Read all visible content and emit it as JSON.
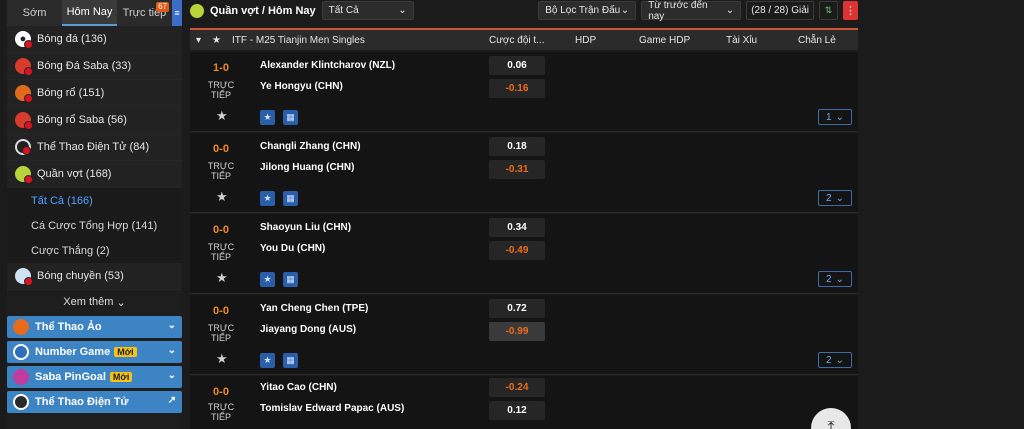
{
  "sidebar": {
    "tabs": [
      {
        "label": "Sớm"
      },
      {
        "label": "Hôm Nay"
      },
      {
        "label": "Trực tiếp",
        "badge": "67"
      }
    ],
    "sports": [
      {
        "label": "Bóng đá (136)",
        "icon": "soccer-icon",
        "color": "#ffffff"
      },
      {
        "label": "Bóng Đá Saba (33)",
        "icon": "soccer-saba-icon",
        "color": "#d83a2e"
      },
      {
        "label": "Bóng rổ (151)",
        "icon": "basketball-icon",
        "color": "#e06a1b"
      },
      {
        "label": "Bóng rổ Saba (56)",
        "icon": "basketball-saba-icon",
        "color": "#d83a2e"
      },
      {
        "label": "Thể Thao Điện Tử (84)",
        "icon": "esports-headset-icon",
        "color": "#dddddd"
      },
      {
        "label": "Quần vợt (168)",
        "icon": "tennis-icon",
        "color": "#b7d43a"
      }
    ],
    "tennis_subs": [
      {
        "label": "Tất Cả (166)"
      },
      {
        "label": "Cá Cược Tổng Hợp (141)"
      },
      {
        "label": "Cược Thắng (2)"
      }
    ],
    "volleyball": {
      "label": "Bóng chuyền (53)",
      "icon": "volleyball-icon"
    },
    "more": "Xem thêm",
    "promos": [
      {
        "label": "Thể Thao Ảo",
        "icon": "virtual-sports-icon",
        "badge": ""
      },
      {
        "label": "Number Game",
        "icon": "number-game-icon",
        "badge": "Mới"
      },
      {
        "label": "Saba PinGoal",
        "icon": "pingoal-icon",
        "badge": "Mới"
      },
      {
        "label": "Thể Thao Điện Tử",
        "icon": "esports-icon",
        "badge": ""
      }
    ]
  },
  "topbar": {
    "title": "Quần vợt / Hôm Nay",
    "filter_value": "Tất Cả",
    "match_filter": "Bộ Lọc Trận Đấu",
    "time_filter": "Từ trước đến nay",
    "count": "(28 / 28) Giải"
  },
  "table": {
    "league": "ITF - M25 Tianjin Men Singles",
    "columns": [
      "Cược đội t...",
      "HDP",
      "Game HDP",
      "Tài Xỉu",
      "Chẵn Lẻ"
    ]
  },
  "matches": [
    {
      "score": "1-0",
      "status": "TRỰC TIẾP",
      "home": "Alexander Klintcharov (NZL)",
      "away": "Ye Hongyu (CHN)",
      "odd_home": "0.06",
      "odd_away": "-0.16",
      "more": "1"
    },
    {
      "score": "0-0",
      "status": "TRỰC TIẾP",
      "home": "Changli Zhang (CHN)",
      "away": "Jilong Huang (CHN)",
      "odd_home": "0.18",
      "odd_away": "-0.31",
      "more": "2"
    },
    {
      "score": "0-0",
      "status": "TRỰC TIẾP",
      "home": "Shaoyun Liu (CHN)",
      "away": "You Du (CHN)",
      "odd_home": "0.34",
      "odd_away": "-0.49",
      "more": "2"
    },
    {
      "score": "0-0",
      "status": "TRỰC TIẾP",
      "home": "Yan Cheng Chen (TPE)",
      "away": "Jiayang Dong (AUS)",
      "odd_home": "0.72",
      "odd_away": "-0.99",
      "more": "2"
    },
    {
      "score": "0-0",
      "status": "TRỰC TIẾP",
      "home": "Yitao Cao (CHN)",
      "away": "Tomislav Edward Papac (AUS)",
      "odd_home": "-0.24",
      "odd_away": "0.12",
      "more": ""
    }
  ]
}
